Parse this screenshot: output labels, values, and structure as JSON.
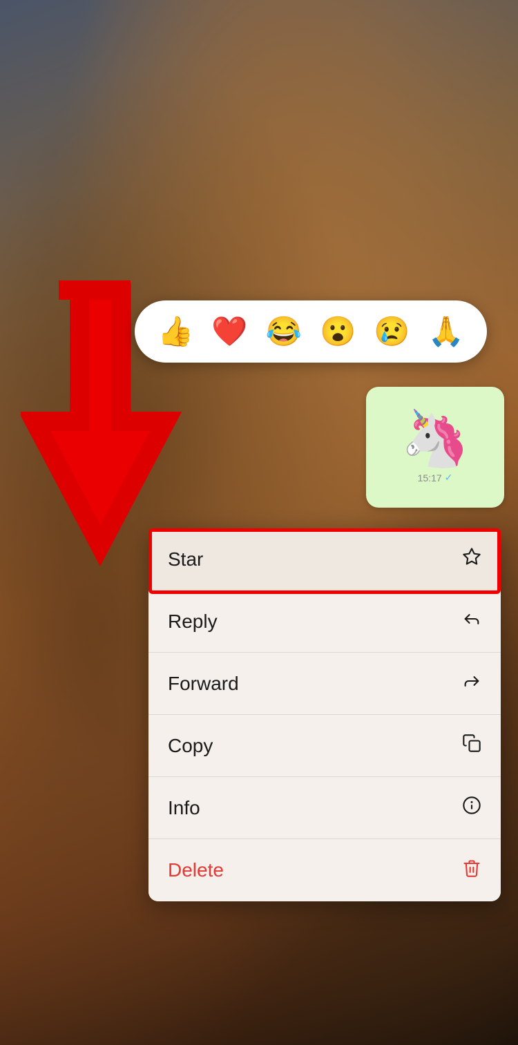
{
  "background": {
    "description": "blurred chat background with warm tones"
  },
  "reaction_bar": {
    "emojis": [
      "👍",
      "❤️",
      "😂",
      "😮",
      "😢",
      "🙏"
    ]
  },
  "message": {
    "emoji": "🦄",
    "time": "15:17",
    "check": "✓"
  },
  "context_menu": {
    "items": [
      {
        "label": "Star",
        "icon": "star"
      },
      {
        "label": "Reply",
        "icon": "reply"
      },
      {
        "label": "Forward",
        "icon": "forward"
      },
      {
        "label": "Copy",
        "icon": "copy"
      },
      {
        "label": "Info",
        "icon": "info"
      },
      {
        "label": "Delete",
        "icon": "trash",
        "danger": true
      }
    ]
  }
}
